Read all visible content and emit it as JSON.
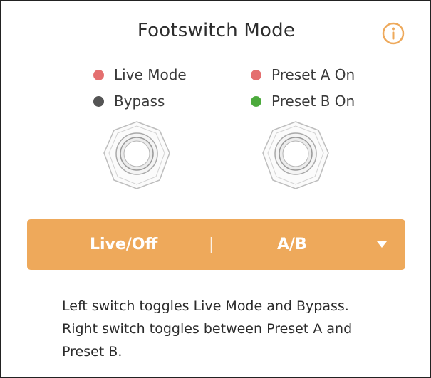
{
  "title": "Footswitch Mode",
  "icons": {
    "info": "info-icon",
    "dropdown": "chevron-down-icon",
    "footswitch": "footswitch-icon"
  },
  "left_legend": [
    {
      "label": "Live Mode",
      "color": "#e46f6f"
    },
    {
      "label": "Bypass",
      "color": "#555555"
    }
  ],
  "right_legend": [
    {
      "label": "Preset A On",
      "color": "#e46f6f"
    },
    {
      "label": "Preset B On",
      "color": "#4caa3c"
    }
  ],
  "mode_selector": {
    "left_value": "Live/Off",
    "separator": "|",
    "right_value": "A/B",
    "color": "#eea95b"
  },
  "description": {
    "line1": "Left switch toggles Live Mode and Bypass.",
    "line2": "Right switch toggles between Preset A and",
    "line3": "Preset B."
  },
  "colors": {
    "accent": "#eea95b",
    "title": "#2e2e2e"
  }
}
